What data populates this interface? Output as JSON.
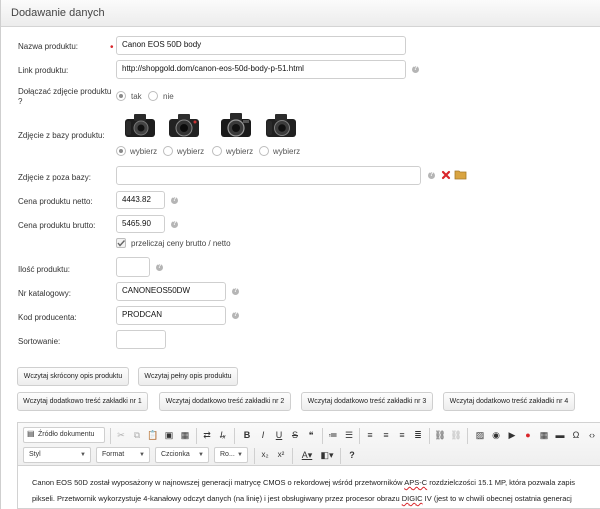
{
  "header": {
    "title": "Dodawanie danych"
  },
  "form": {
    "product_name_label": "Nazwa produktu:",
    "product_name_value": "Canon EOS 50D body",
    "link_label": "Link produktu:",
    "link_value": "http://shopgold.dom/canon-eos-50d-body-p-51.html",
    "attach_photo_label_line1": "Dołączać zdjęcie produktu",
    "attach_photo_label_line2": "?",
    "attach_yes": "tak",
    "attach_no": "nie",
    "photos_label": "Zdjęcie z bazy produktu:",
    "photo_options": [
      "wybierz",
      "wybierz",
      "wybierz",
      "wybierz"
    ],
    "external_photo_label": "Zdjęcie z poza bazy:",
    "external_photo_value": "",
    "net_price_label": "Cena produktu netto:",
    "net_price_value": "4443.82",
    "gross_price_label": "Cena produktu brutto:",
    "gross_price_value": "5465.90",
    "recalc_label": "przeliczaj ceny brutto / netto",
    "quantity_label": "Ilość produktu:",
    "quantity_value": "",
    "catalog_label": "Nr katalogowy:",
    "catalog_value": "CANONEOS50DW",
    "producer_code_label": "Kod producenta:",
    "producer_code_value": "PRODCAN",
    "sort_label": "Sortowanie:",
    "sort_value": ""
  },
  "buttons": {
    "short_desc": "Wczytaj skrócony opis produktu",
    "full_desc": "Wczytaj pełny opis produktu",
    "tab1": "Wczytaj dodatkowo treść zakładki nr 1",
    "tab2": "Wczytaj dodatkowo treść zakładki nr 2",
    "tab3": "Wczytaj dodatkowo treść zakładki nr 3",
    "tab4": "Wczytaj dodatkowo treść zakładki nr 4"
  },
  "editor": {
    "source_label": "Źródło dokumentu",
    "style_combo": "Styl",
    "format_combo": "Format",
    "font_combo": "Czcionka",
    "size_combo": "Ro...",
    "content_line1_a": "Canon EOS 50D został wyposażony w najnowszej generacji matrycę CMOS o rekordowej wśród przetworników ",
    "content_line1_sq": "APS-C",
    "content_line1_b": " rozdzielczości 15.1 MP, która pozwala zapis",
    "content_line2_a": "pikseli. Przetwornik wykorzystuje  4-kanałowy odczyt danych (na linię) i jest obsługiwany przez procesor obrazu ",
    "content_line2_sq": "DIGIC",
    "content_line2_b": " IV (jest to w chwili obecnej ostatnia generacj"
  },
  "colors": {
    "required": "#d9262b",
    "delete": "#d9262b",
    "folder": "#d9a441"
  }
}
